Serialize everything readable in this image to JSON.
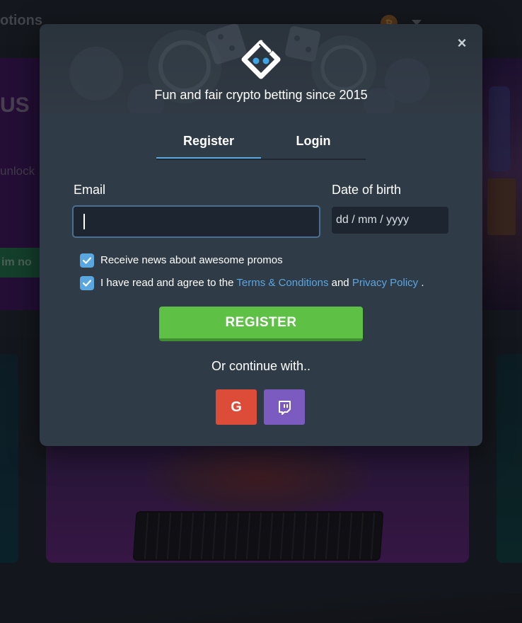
{
  "background": {
    "topbar_text": "otions",
    "promo_heading": "US",
    "promo_text": "unlock",
    "claim_label": "im no",
    "coin_symbol": "₿"
  },
  "modal": {
    "tagline": "Fun and fair crypto betting since 2015",
    "close_label": "×",
    "tabs": [
      {
        "label": "Register",
        "active": true
      },
      {
        "label": "Login",
        "active": false
      }
    ],
    "email": {
      "label": "Email",
      "value": "",
      "placeholder": ""
    },
    "dob": {
      "label": "Date of birth",
      "placeholder": "dd / mm / yyyy"
    },
    "checkboxes": {
      "news": {
        "checked": true,
        "text": "Receive news about awesome promos"
      },
      "terms": {
        "checked": true,
        "prefix": "I have read and agree to the",
        "terms_link": "Terms & Conditions",
        "and": "and",
        "privacy_link": "Privacy Policy",
        "suffix": "."
      }
    },
    "register_label": "REGISTER",
    "continue_text": "Or continue with..",
    "social": {
      "google_glyph": "G",
      "google_icon": "google-icon",
      "twitch_icon": "twitch-icon"
    }
  },
  "colors": {
    "accent_blue": "#5aa6e0",
    "register_green": "#5ec145",
    "google_red": "#dd4b39",
    "twitch_purple": "#7b5bbf",
    "modal_bg": "#2f3b47"
  }
}
